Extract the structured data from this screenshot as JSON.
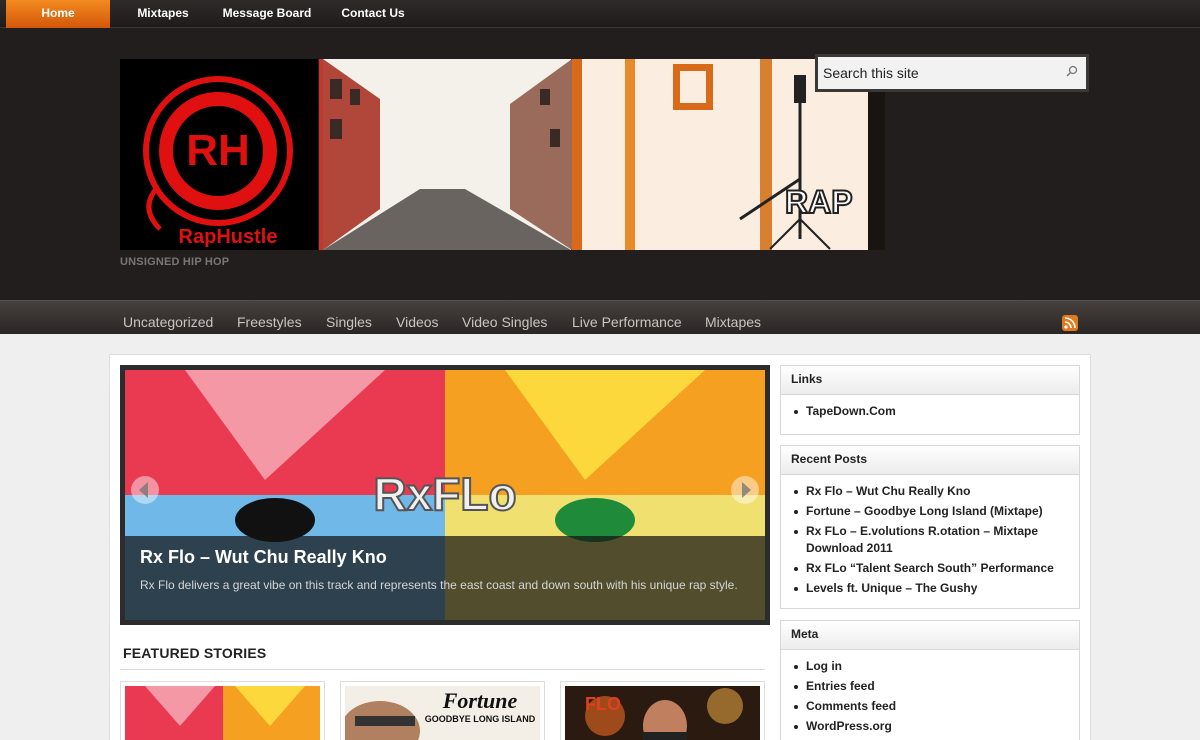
{
  "topnav": [
    {
      "label": "Home",
      "active": true
    },
    {
      "label": "Mixtapes"
    },
    {
      "label": "Message Board"
    },
    {
      "label": "Contact Us"
    }
  ],
  "header": {
    "tagline": "UNSIGNED HIP HOP",
    "logo_text": "RH",
    "logo_name": "RapHustle",
    "banner_text_1": "",
    "banner_text_2": "RAP"
  },
  "search": {
    "placeholder": "Search this site"
  },
  "categories": [
    "Uncategorized",
    "Freestyles",
    "Singles",
    "Videos",
    "Video Singles",
    "Live Performance",
    "Mixtapes"
  ],
  "slider": {
    "title": "Rx Flo – Wut Chu Really Kno",
    "description": "Rx Flo delivers a great vibe on this track and represents the east coast and down south with his unique rap style.",
    "image_text": "RxFLo"
  },
  "featured": {
    "heading": "FEATURED STORIES"
  },
  "widgets": {
    "links": {
      "title": "Links",
      "items": [
        "TapeDown.Com"
      ]
    },
    "recent": {
      "title": "Recent Posts",
      "items": [
        "Rx Flo – Wut Chu Really Kno",
        "Fortune – Goodbye Long Island (Mixtape)",
        "Rx FLo – E.volutions R.otation – Mixtape Download 2011",
        "Rx FLo “Talent Search South” Performance",
        "Levels ft. Unique – The Gushy"
      ]
    },
    "meta": {
      "title": "Meta",
      "items": [
        "Log in",
        "Entries feed",
        "Comments feed",
        "WordPress.org"
      ]
    }
  },
  "thumbs": {
    "fortune_title": "Fortune",
    "fortune_sub": "GOODBYE LONG ISLAND",
    "flo_text": "FLO"
  },
  "colors": {
    "accent": "#e8741a",
    "header_bg": "#221e1d"
  }
}
